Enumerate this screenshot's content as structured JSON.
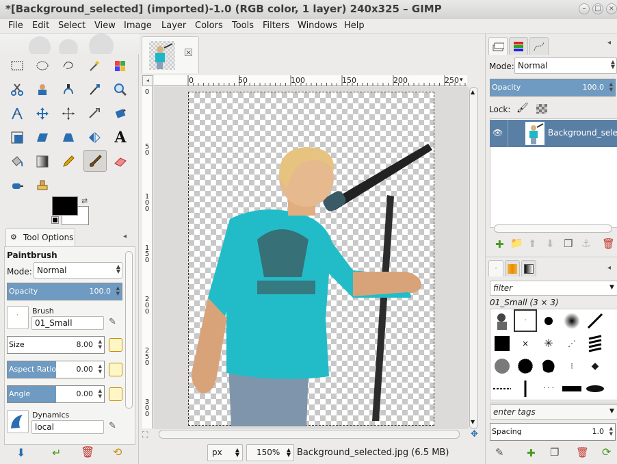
{
  "window": {
    "title": "*[Background_selected] (imported)-1.0 (RGB color, 1 layer) 240x325 – GIMP"
  },
  "menu": [
    "File",
    "Edit",
    "Select",
    "View",
    "Image",
    "Layer",
    "Colors",
    "Tools",
    "Filters",
    "Windows",
    "Help"
  ],
  "tool_options": {
    "tab_label": "Tool Options",
    "tool_name": "Paintbrush",
    "mode_label": "Mode:",
    "mode_value": "Normal",
    "opacity_label": "Opacity",
    "opacity_value": "100.0",
    "opacity_fraction": 1.0,
    "brush_label": "Brush",
    "brush_value": "01_Small",
    "size_label": "Size",
    "size_value": "8.00",
    "aspect_label": "Aspect Ratio",
    "aspect_value": "0.00",
    "aspect_fraction": 0.5,
    "angle_label": "Angle",
    "angle_value": "0.00",
    "angle_fraction": 0.5,
    "dynamics_label": "Dynamics",
    "dynamics_value": "local"
  },
  "colors": {
    "foreground": "#000000",
    "background": "#ffffff",
    "accent": "#6f9ac1",
    "selection": "#5a7fa5"
  },
  "ruler_h": [
    "0",
    "50",
    "100",
    "150",
    "200",
    "250"
  ],
  "ruler_v": [
    "0",
    "5\n0",
    "1\n0\n0",
    "1\n5\n0",
    "2\n0\n0",
    "2\n5\n0",
    "3\n0\n0"
  ],
  "status": {
    "unit": "px",
    "zoom": "150%",
    "file_info": "Background_selected.jpg (6.5 MB)"
  },
  "layers": {
    "mode_label": "Mode:",
    "mode_value": "Normal",
    "opacity_label": "Opacity",
    "opacity_value": "100.0",
    "lock_label": "Lock:",
    "layer_name": "Background_selected"
  },
  "brushes": {
    "filter_placeholder": "filter",
    "current_brush": "01_Small (3 × 3)",
    "tags_placeholder": "enter tags",
    "spacing_label": "Spacing",
    "spacing_value": "1.0"
  }
}
